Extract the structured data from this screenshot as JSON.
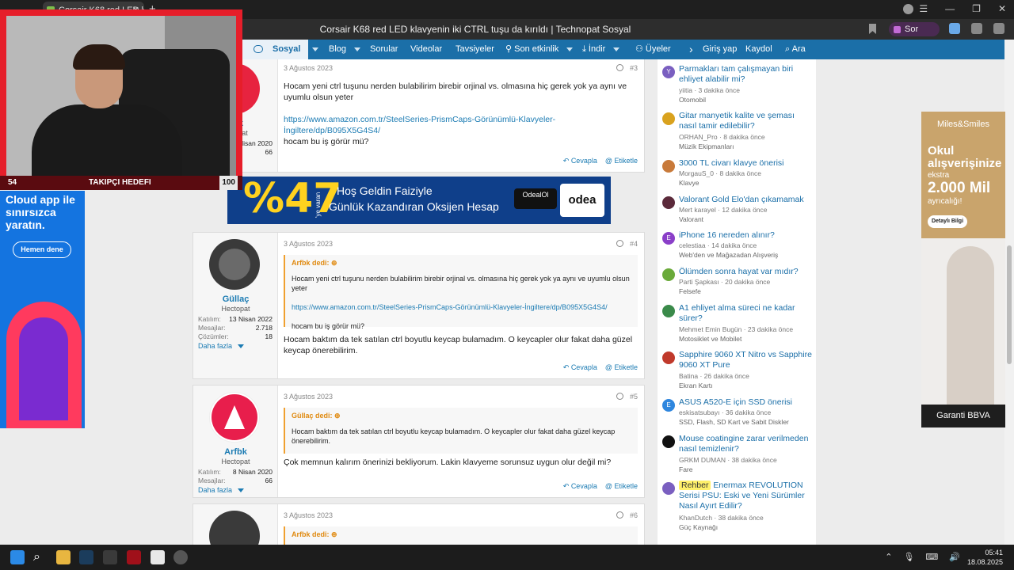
{
  "browser": {
    "tab_title": "Corsair K68 red LED kla",
    "page_title": "Corsair K68 red LED klavyenin iki CTRL tuşu da kırıldı | Technopat Sosyal",
    "profile_label": "Sor"
  },
  "nav": {
    "partial": "a",
    "active": "Sosyal",
    "items": [
      "Blog",
      "Sorular",
      "Videolar",
      "Tavsiyeler",
      "Son etkinlik",
      "İndir",
      "Üyeler"
    ],
    "login": "Giriş yap",
    "register": "Kaydol",
    "search": "Ara"
  },
  "posts": [
    {
      "date": "3 Ağustos 2023",
      "number": "#3",
      "user_partial": "k",
      "user_partial_title": "at",
      "join_partial": "Nisan 2020",
      "msgs_partial": "66",
      "text1": "Hocam yeni ctrl tuşunu nerden bulabilirim birebir orjinal vs. olmasına hiç gerek yok ya aynı ve uyumlu olsun yeter",
      "link": "https://www.amazon.com.tr/SteelSeries-PrismCaps-Görünümlü-Klavyeler-İngiltere/dp/B095X5G4S4/",
      "text2": "hocam bu iş görür mü?",
      "reply": "Cevapla",
      "tag": "Etiketle"
    },
    {
      "date": "3 Ağustos 2023",
      "number": "#4",
      "username": "Güllaç",
      "usertitle": "Hectopat",
      "stats": [
        [
          "Katılım:",
          "13 Nisan 2022"
        ],
        [
          "Mesajlar:",
          "2.718"
        ],
        [
          "Çözümler:",
          "18"
        ]
      ],
      "more": "Daha fazla",
      "quote_author": "Arfbk dedi:",
      "quote_text1": "Hocam yeni ctrl tuşunu nerden bulabilirim birebir orjinal vs. olmasına hiç gerek yok ya aynı ve uyumlu olsun yeter",
      "quote_link": "https://www.amazon.com.tr/SteelSeries-PrismCaps-Görünümlü-Klavyeler-İngiltere/dp/B095X5G4S4/",
      "quote_text2": "hocam bu iş görür mü?",
      "text": "Hocam baktım da tek satılan ctrl boyutlu keycap bulamadım. O keycapler olur fakat daha güzel keycap önerebilirim.",
      "reply": "Cevapla",
      "tag": "Etiketle"
    },
    {
      "date": "3 Ağustos 2023",
      "number": "#5",
      "username": "Arfbk",
      "usertitle": "Hectopat",
      "stats": [
        [
          "Katılım:",
          "8 Nisan 2020"
        ],
        [
          "Mesajlar:",
          "66"
        ]
      ],
      "more": "Daha fazla",
      "quote_author": "Güllaç dedi:",
      "quote_text": "Hocam baktım da tek satılan ctrl boyutlu keycap bulamadım. O keycapler olur fakat daha güzel keycap önerebilirim.",
      "text": "Çok memnun kalırım önerinizi bekliyorum. Lakin klavyeme sorunsuz uygun olur değil mi?",
      "reply": "Cevapla",
      "tag": "Etiketle"
    },
    {
      "date": "3 Ağustos 2023",
      "number": "#6",
      "quote_author": "Arfbk dedi:"
    }
  ],
  "sidebar": [
    {
      "icon": "Y",
      "title": "Parmakları tam çalışmayan biri ehliyet alabilir mi?",
      "meta": "yiitia · 3 dakika önce",
      "forum": "Otomobil"
    },
    {
      "icon": "",
      "title": "Gitar manyetik kalite ve şeması nasıl tamir edilebilir?",
      "meta": "ORHAN_Pro · 8 dakika önce",
      "forum": "Müzik Ekipmanları"
    },
    {
      "icon": "",
      "title": "3000 TL civarı klavye önerisi",
      "meta": "MorgauS_0 · 8 dakika önce",
      "forum": "Klavye"
    },
    {
      "icon": "",
      "title": "Valorant Gold Elo'dan çıkamamak",
      "meta": "Mert karayel · 12 dakika önce",
      "forum": "Valorant"
    },
    {
      "icon": "E",
      "title": "iPhone 16 nereden alınır?",
      "meta": "celestiaa · 14 dakika önce",
      "forum": "Web'den ve Mağazadan Alışveriş"
    },
    {
      "icon": "",
      "title": "Ölümden sonra hayat var mıdır?",
      "meta": "Parti Şapkası · 20 dakika önce",
      "forum": "Felsefe"
    },
    {
      "icon": "",
      "title": "A1 ehliyet alma süreci ne kadar sürer?",
      "meta": "Mehmet Emin Bugün · 23 dakika önce",
      "forum": "Motosiklet ve Mobilet"
    },
    {
      "icon": "",
      "title": "Sapphire 9060 XT Nitro vs Sapphire 9060 XT Pure",
      "meta": "Batina · 26 dakika önce",
      "forum": "Ekran Kartı"
    },
    {
      "icon": "E",
      "title": "ASUS A520-E için SSD önerisi",
      "meta": "eskisatsubayı · 36 dakika önce",
      "forum": "SSD, Flash, SD Kart ve Sabit Diskler"
    },
    {
      "icon": "",
      "title": "Mouse coatingine zarar verilmeden nasıl temizlenir?",
      "meta": "GRKM DUMAN · 38 dakika önce",
      "forum": "Fare"
    },
    {
      "icon": "",
      "tag": "Rehber",
      "title": "Enermax REVOLUTION Serisi PSU: Eski ve Yeni Sürümler Nasıl Ayırt Edilir?",
      "meta": "KhanDutch · 38 dakika önce",
      "forum": "Güç Kaynağı"
    }
  ],
  "ads": {
    "left": {
      "headline": "Cloud app ile sınırsızca yaratın.",
      "button": "Hemen dene"
    },
    "banner": {
      "percent": "%47",
      "side": "'ye varan",
      "line1": "Hoş Geldin Faiziyle",
      "line2": "Günlük Kazandıran Oksijen Hesap",
      "logo1": "OdealOl",
      "logo2": "odea"
    },
    "right": {
      "brand": "Miles&Smiles",
      "line1": "Okul alışverişinize",
      "line2": "ekstra",
      "line3": "2.000 Mil",
      "line4": "ayrıcalığı!",
      "button": "Detaylı Bilgi",
      "footer": "Garanti BBVA"
    }
  },
  "stream": {
    "left_value": "54",
    "label": "TAKIPÇI HEDEFI",
    "right_value": "100"
  },
  "taskbar": {
    "time": "05:41",
    "date": "18.08.2025"
  }
}
